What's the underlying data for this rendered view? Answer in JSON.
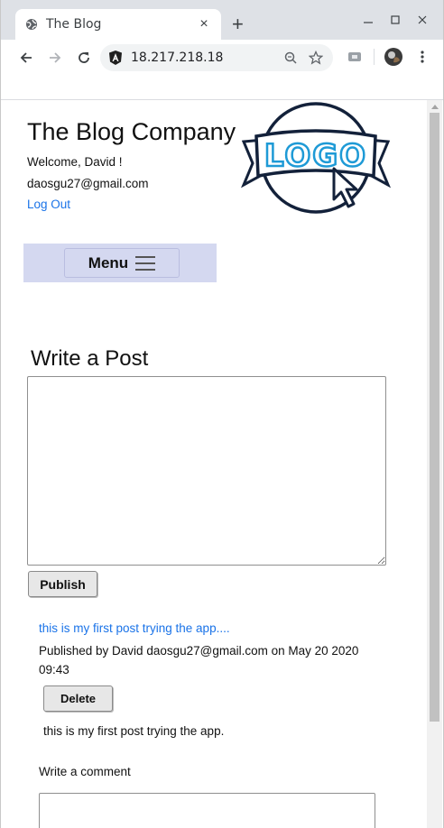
{
  "browser": {
    "tab_title": "The Blog",
    "url": "18.217.218.18",
    "tab_close_glyph": "×",
    "new_tab_glyph": "+",
    "window_buttons": [
      "–",
      "☐",
      "✕"
    ],
    "accent": "#1a73e8"
  },
  "header": {
    "site_title": "The Blog Company",
    "welcome": "Welcome, David !",
    "email": "daosgu27@gmail.com",
    "logout_label": "Log Out",
    "logo_text": "LOGO"
  },
  "menu": {
    "label": "Menu"
  },
  "compose": {
    "heading": "Write a Post",
    "textarea_value": "",
    "publish_label": "Publish"
  },
  "post": {
    "title": "this is my first post trying the app....",
    "meta": "Published by David daosgu27@gmail.com on May 20 2020 09:43",
    "delete_label": "Delete",
    "body": "this is my first post trying the app.",
    "comment_label": "Write a comment",
    "comment_value": ""
  }
}
